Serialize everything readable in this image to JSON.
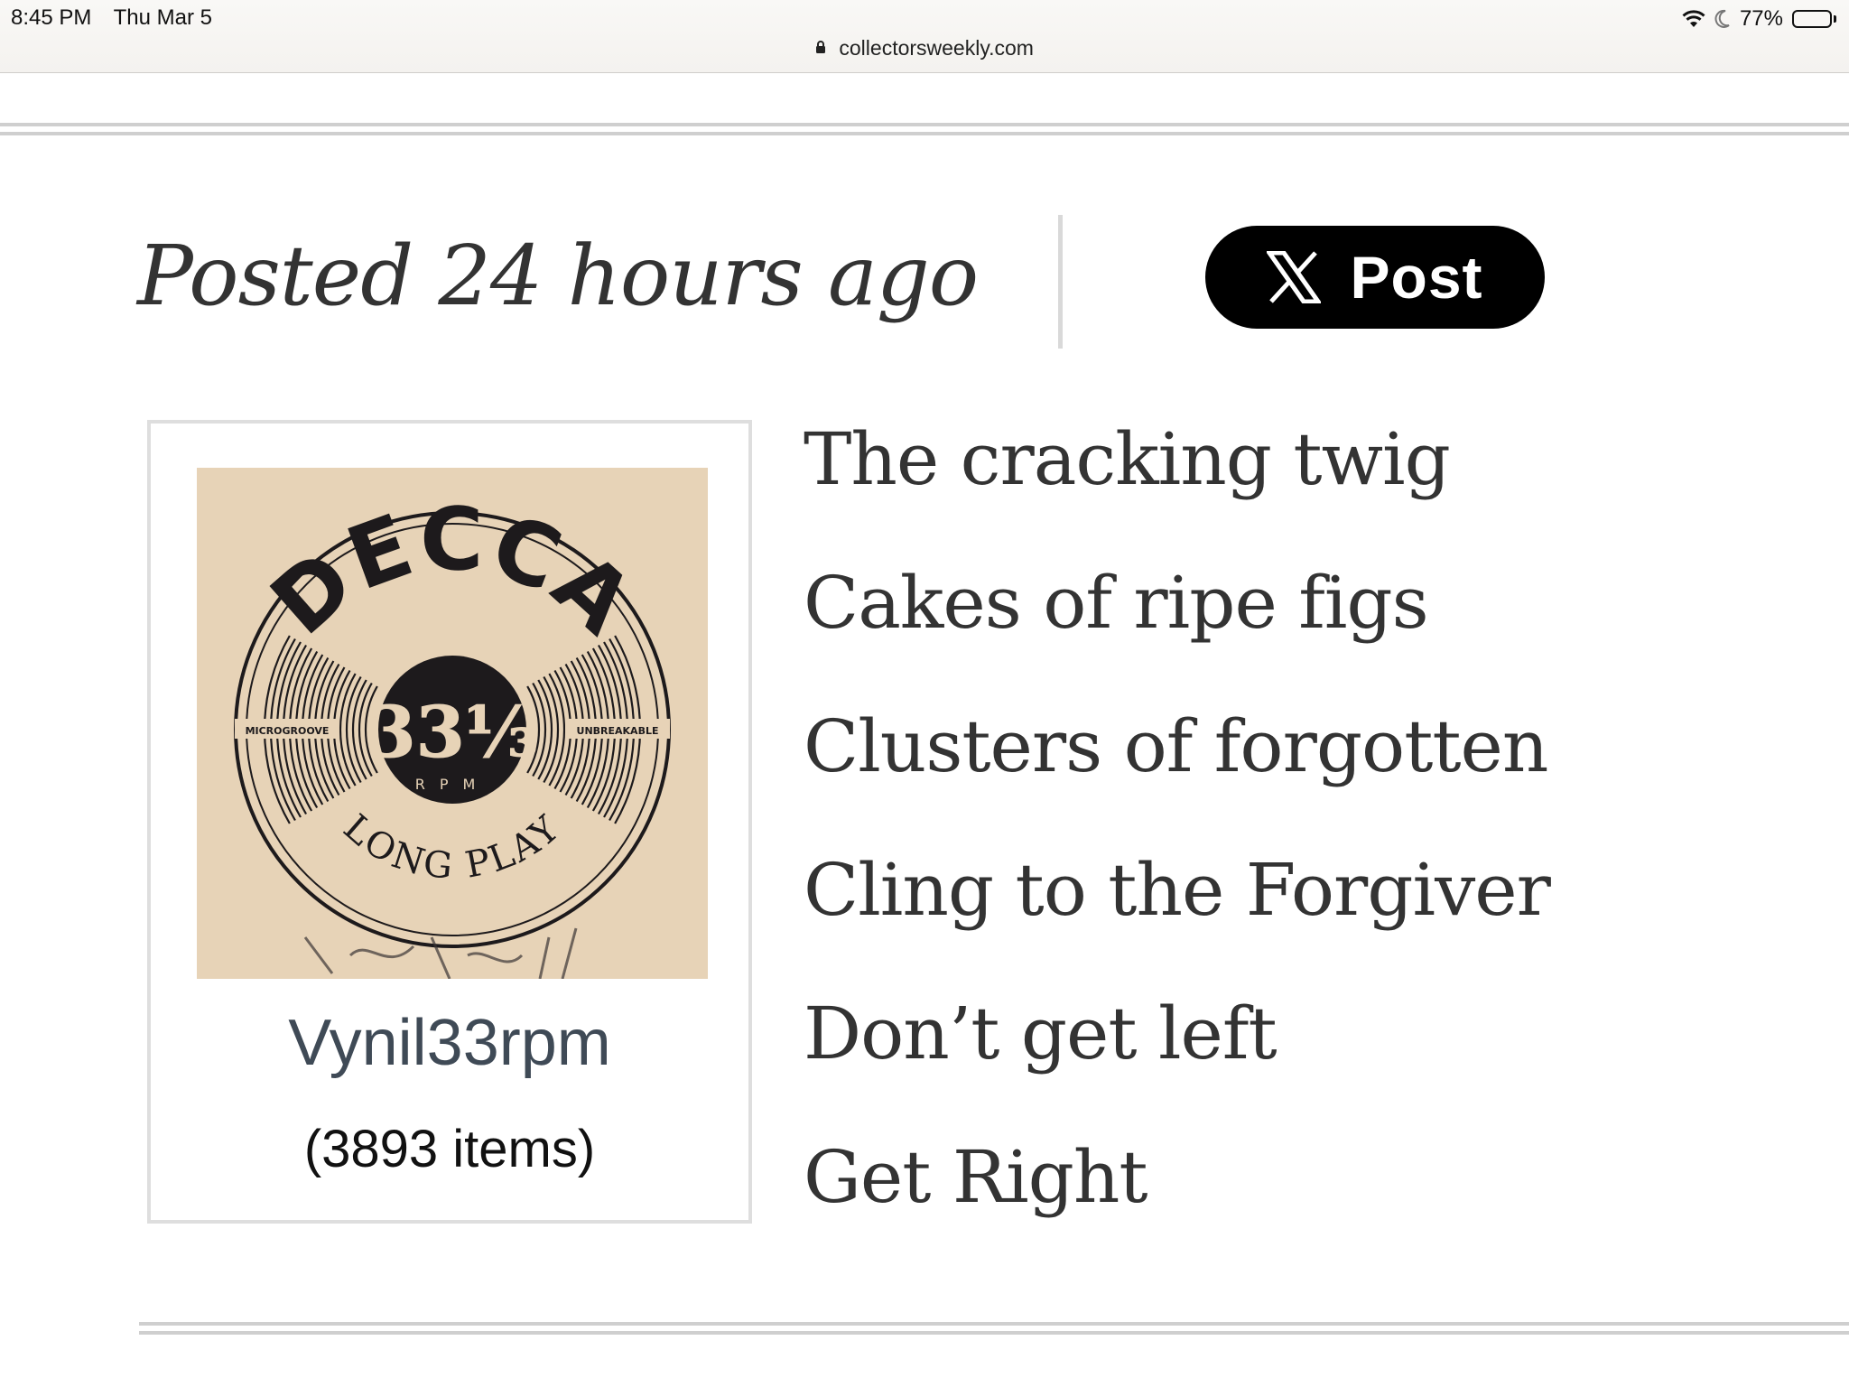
{
  "status_bar": {
    "time": "8:45 PM",
    "date": "Thu Mar 5",
    "battery_percent": "77%",
    "battery_level": 0.77,
    "icons": [
      "wifi-icon",
      "moon-icon",
      "battery-icon"
    ]
  },
  "browser": {
    "url": "collectorsweekly.com",
    "icon": "lock-icon"
  },
  "post": {
    "posted_text": "Posted 24 hours ago",
    "share_button": {
      "icon": "x-logo-icon",
      "label": "Post"
    }
  },
  "profile": {
    "username": "Vynil33rpm",
    "item_count": "(3893 items)",
    "avatar": {
      "brand": "DECCA",
      "speed": "33⅓",
      "unit": "RPM",
      "left_label": "MICROGROOVE",
      "right_label": "UNBREAKABLE",
      "bottom_label": "LONG PLAY",
      "background_color": "#e7d3b7",
      "ink_color": "#1d1a1c"
    }
  },
  "poem_lines": [
    "The cracking twig",
    "Cakes of ripe figs",
    "Clusters of forgotten",
    "Cling to the Forgiver",
    "Don’t get left",
    "Get Right"
  ]
}
